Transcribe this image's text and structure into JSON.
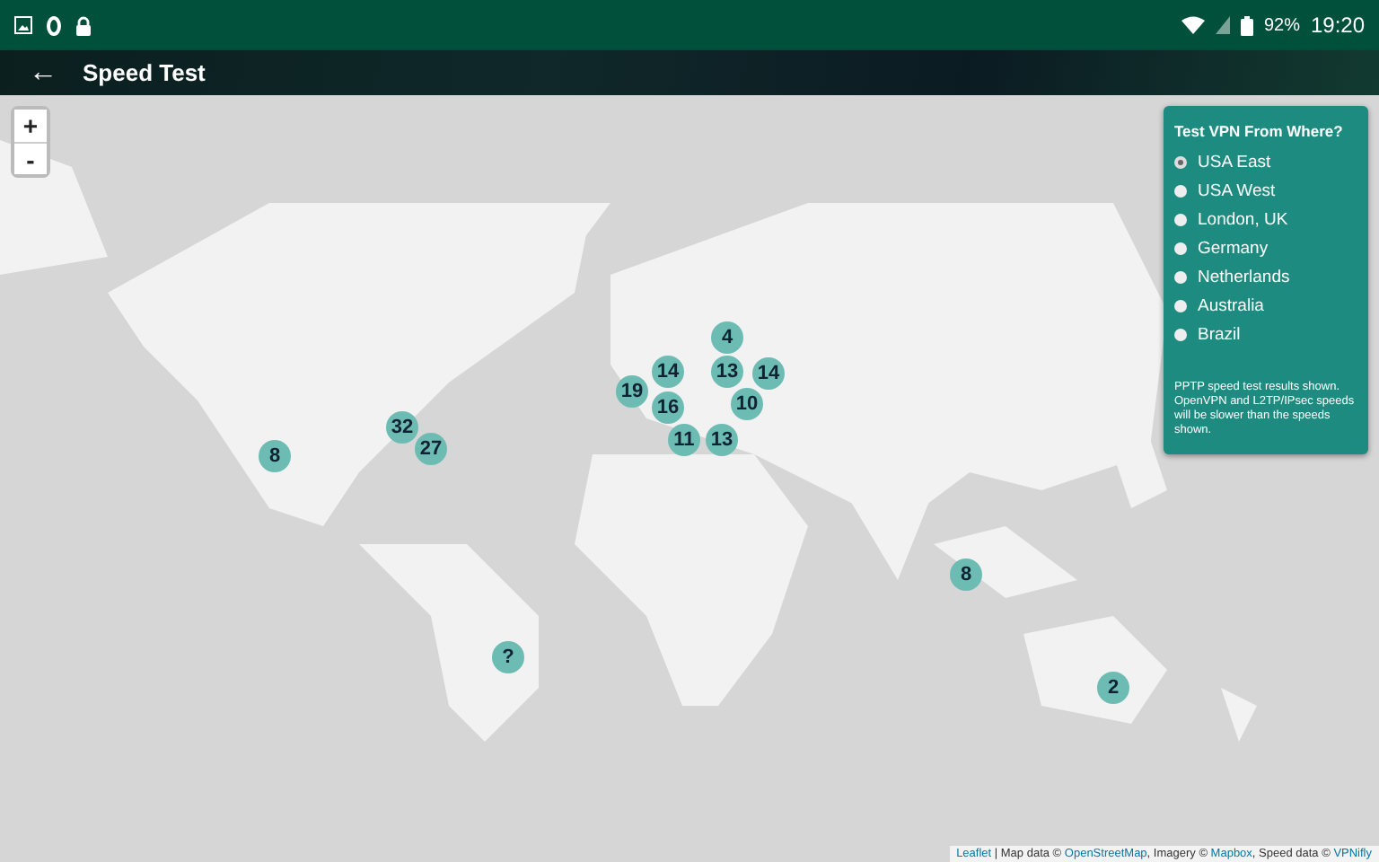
{
  "status_bar": {
    "battery_text": "92%",
    "time": "19:20"
  },
  "app_bar": {
    "back": "←",
    "title": "Speed Test"
  },
  "zoom": {
    "in": "+",
    "out": "-"
  },
  "panel": {
    "title": "Test VPN From Where?",
    "options": [
      {
        "label": "USA East",
        "selected": true
      },
      {
        "label": "USA West",
        "selected": false
      },
      {
        "label": "London, UK",
        "selected": false
      },
      {
        "label": "Germany",
        "selected": false
      },
      {
        "label": "Netherlands",
        "selected": false
      },
      {
        "label": "Australia",
        "selected": false
      },
      {
        "label": "Brazil",
        "selected": false
      }
    ],
    "note": "PPTP speed test results shown. OpenVPN and L2TP/IPsec speeds will be slower than the speeds shown."
  },
  "markers": [
    "8",
    "32",
    "27",
    "4",
    "13",
    "14",
    "19",
    "14",
    "16",
    "11",
    "10",
    "13",
    "8",
    "?",
    "2"
  ],
  "attribution": [
    {
      "kind": "link",
      "text": "Leaflet"
    },
    {
      "kind": "text",
      "text": " | Map data © "
    },
    {
      "kind": "link",
      "text": "OpenStreetMap"
    },
    {
      "kind": "text",
      "text": ", Imagery © "
    },
    {
      "kind": "link",
      "text": "Mapbox"
    },
    {
      "kind": "text",
      "text": ", Speed data © "
    },
    {
      "kind": "link",
      "text": "VPNifly"
    }
  ]
}
